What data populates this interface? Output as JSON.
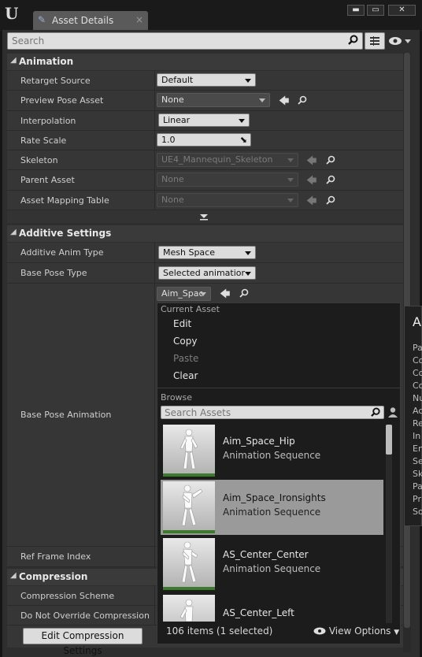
{
  "window": {
    "tab_title": "Asset Details",
    "tab_close": "×",
    "minimize": "▬",
    "maximize": "▭",
    "close": "✕"
  },
  "search": {
    "placeholder": "Search"
  },
  "sections": {
    "animation": "Animation",
    "additive": "Additive Settings",
    "compression": "Compression"
  },
  "animation_rows": [
    {
      "name": "Retarget Source",
      "value": "Default"
    },
    {
      "name": "Preview Pose Asset",
      "value": "None"
    },
    {
      "name": "Interpolation",
      "value": "Linear"
    },
    {
      "name": "Rate Scale",
      "value": "1.0"
    },
    {
      "name": "Skeleton",
      "value": "UE4_Mannequin_Skeleton"
    },
    {
      "name": "Parent Asset",
      "value": "None"
    },
    {
      "name": "Asset Mapping Table",
      "value": "None"
    }
  ],
  "additive_rows": [
    {
      "name": "Additive Anim Type",
      "value": "Mesh Space"
    },
    {
      "name": "Base Pose Type",
      "value": "Selected animation"
    },
    {
      "name": "Base Pose Animation",
      "value": "Aim_Space"
    },
    {
      "name": "Ref Frame Index",
      "value": ""
    }
  ],
  "compression_rows": [
    {
      "name": "Compression Scheme"
    },
    {
      "name": "Do Not Override Compression"
    }
  ],
  "edit_compression_button": "Edit Compression Settings",
  "popup": {
    "current_asset_header": "Current Asset",
    "menu": [
      "Edit",
      "Copy",
      "Paste",
      "Clear"
    ],
    "browse_header": "Browse",
    "search_placeholder": "Search Assets",
    "items": [
      {
        "name": "Aim_Space_Hip",
        "type": "Animation Sequence",
        "selected": false
      },
      {
        "name": "Aim_Space_Ironsights",
        "type": "Animation Sequence",
        "selected": true
      },
      {
        "name": "AS_Center_Center",
        "type": "Animation Sequence",
        "selected": false
      },
      {
        "name": "AS_Center_Left",
        "type": "",
        "selected": false
      }
    ],
    "count": "106 items (1 selected)",
    "view_options": "View Options"
  },
  "tooltip": {
    "title": "A",
    "lines": [
      "Pa",
      "Co",
      "Co",
      "Co",
      "Nu",
      "Ac",
      "Re",
      "In",
      "En",
      "Se",
      "Sk",
      "Pa",
      "Pr",
      "So"
    ]
  }
}
